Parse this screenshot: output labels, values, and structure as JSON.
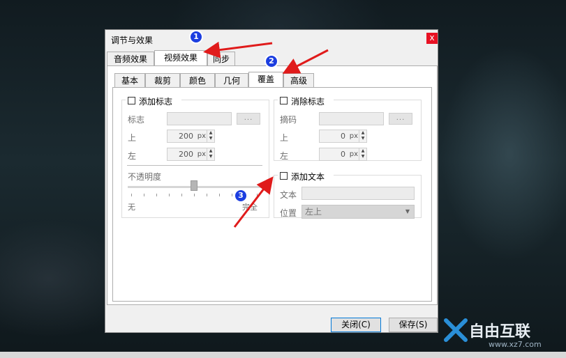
{
  "dialog": {
    "title": "调节与效果",
    "close_glyph": "x",
    "main_tabs": [
      "音频效果",
      "视频效果",
      "同步"
    ],
    "sub_tabs": [
      "基本",
      "裁剪",
      "颜色",
      "几何",
      "覆盖",
      "高级"
    ],
    "add_logo": {
      "label": "添加标志",
      "logo_label": "标志",
      "browse": "...",
      "top_label": "上",
      "top_value": "200",
      "left_label": "左",
      "left_value": "200",
      "unit": "px",
      "opacity_label": "不透明度",
      "min_label": "无",
      "max_label": "完全",
      "opacity_level": 0.5
    },
    "remove_logo": {
      "label": "消除标志",
      "mask_label": "摘码",
      "browse": "...",
      "top_label": "上",
      "top_value": "0",
      "left_label": "左",
      "left_value": "0",
      "unit": "px"
    },
    "add_text": {
      "label": "添加文本",
      "text_label": "文本",
      "text_value": "",
      "position_label": "位置",
      "position_value": "左上"
    },
    "buttons": {
      "close": "关闭(C)",
      "save": "保存(S)"
    }
  },
  "annotations": {
    "badge1": "1",
    "badge2": "2",
    "badge3": "3"
  },
  "watermark": {
    "brand": "自由互联",
    "url": "www.xz7.com"
  },
  "colors": {
    "accent": "#0078d7",
    "arrow": "#e01b1b",
    "badge": "#1c3ee0",
    "close": "#e81123"
  }
}
